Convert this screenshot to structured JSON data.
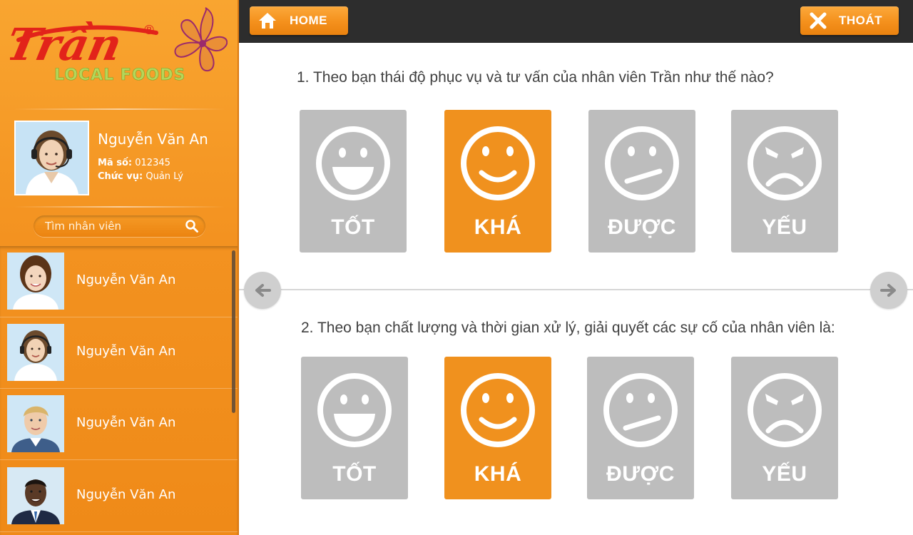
{
  "brand": {
    "logo_text": "Trần",
    "logo_registered": "®",
    "logo_subtitle": "LOCAL FOODS",
    "colors": {
      "primary": "#f39220",
      "accent_red": "#e2231a",
      "accent_green": "#9dc33b",
      "flower": "#9b2a6c"
    }
  },
  "topbar": {
    "home_label": "HOME",
    "home_icon": "home-icon",
    "exit_label": "THOÁT",
    "exit_icon": "close-icon"
  },
  "profile": {
    "name": "Nguyễn Văn An",
    "code_label": "Mã số:",
    "code_value": "012345",
    "role_label": "Chức vụ:",
    "role_value": "Quản Lý"
  },
  "search": {
    "placeholder": "Tìm nhân viên",
    "icon": "search-icon"
  },
  "staff_list": [
    {
      "name": "Nguyễn Văn An"
    },
    {
      "name": "Nguyễn Văn An"
    },
    {
      "name": "Nguyễn Văn An"
    },
    {
      "name": "Nguyễn Văn An"
    }
  ],
  "questions": [
    {
      "text": "1. Theo bạn thái độ phục vụ và tư vấn của nhân viên Trần như thế nào?",
      "selected": "KHÁ",
      "options": [
        {
          "label": "TỐT",
          "icon": "very-happy-face-icon"
        },
        {
          "label": "KHÁ",
          "icon": "smile-face-icon"
        },
        {
          "label": "ĐƯỢC",
          "icon": "neutral-face-icon"
        },
        {
          "label": "YẾU",
          "icon": "angry-face-icon"
        }
      ]
    },
    {
      "text": "2. Theo bạn chất lượng và thời gian xử lý, giải quyết các sự cố của nhân viên là:",
      "selected": "KHÁ",
      "options": [
        {
          "label": "TỐT",
          "icon": "very-happy-face-icon"
        },
        {
          "label": "KHÁ",
          "icon": "smile-face-icon"
        },
        {
          "label": "ĐƯỢC",
          "icon": "neutral-face-icon"
        },
        {
          "label": "YẾU",
          "icon": "angry-face-icon"
        }
      ]
    }
  ],
  "navigation": {
    "prev_icon": "arrow-left-icon",
    "next_icon": "arrow-right-icon"
  },
  "colors": {
    "option_default": "#bdbdbd",
    "option_selected": "#f0911e",
    "topbar": "#2d2d2d"
  }
}
